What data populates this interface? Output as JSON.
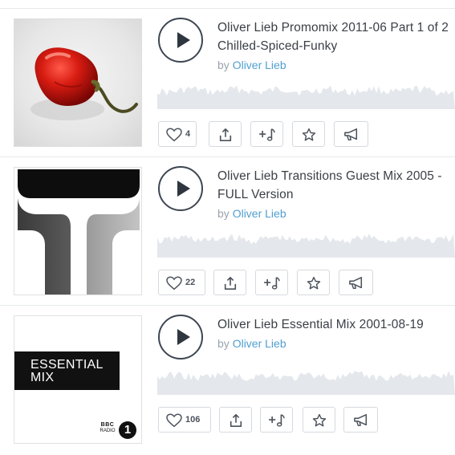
{
  "tracks": [
    {
      "title_line1": "Oliver Lieb Promomix 2011-06 Part 1 of 2",
      "title_line2": "Chilled-Spiced-Funky",
      "by_label": "by",
      "artist": "Oliver Lieb",
      "likes": "4",
      "artwork": "red-pepper-photo"
    },
    {
      "title_line1": "Oliver Lieb Transitions Guest Mix 2005 -",
      "title_line2": "FULL Version",
      "by_label": "by",
      "artist": "Oliver Lieb",
      "likes": "22",
      "artwork": "transitions-t-logo"
    },
    {
      "title_line1": "Oliver Lieb Essential Mix 2001-08-19",
      "by_label": "by",
      "artist": "Oliver Lieb",
      "likes": "106",
      "artwork": "essential-mix-logo",
      "artwork_text_line1": "ESSENTIAL",
      "artwork_text_line2": "MIX",
      "artwork_badge_line1": "BBC",
      "artwork_badge_line2": "RADIO",
      "artwork_badge_number": "1"
    }
  ],
  "icons": {
    "play": "play-icon",
    "like": "heart-icon",
    "share": "share-icon",
    "add": "add-to-playlist-icon",
    "favorite": "star-icon",
    "promote": "megaphone-icon"
  },
  "colors": {
    "text": "#3a3f46",
    "link": "#4f9fd0",
    "muted": "#9aa3ad",
    "waveform": "#e4e8ec",
    "border": "#d5d9de"
  }
}
